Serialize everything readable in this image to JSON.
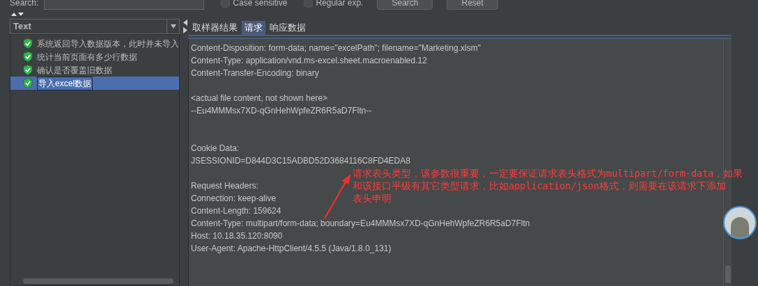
{
  "search_bar": {
    "label": "Search:",
    "case_sensitive": {
      "label": "Case sensitive",
      "checked": false
    },
    "regular_exp": {
      "label": "Regular exp.",
      "checked": false
    },
    "buttons": [
      "Search",
      "Reset"
    ]
  },
  "renderer": {
    "value": "Text"
  },
  "tree": [
    {
      "label": "系统返回导入数据版本，此时并未导入",
      "selected": false
    },
    {
      "label": "统计当前页面有多少行数据",
      "selected": false
    },
    {
      "label": "确认是否覆盖旧数据",
      "selected": false
    },
    {
      "label": "导入excel数据",
      "selected": true
    }
  ],
  "tabs": [
    {
      "label": "取样器结果",
      "selected": false
    },
    {
      "label": "请求",
      "selected": true
    },
    {
      "label": "响应数据",
      "selected": false
    }
  ],
  "request_sections": [
    [
      "Content-Disposition: form-data; name=\"excelPath\"; filename=\"Marketing.xlsm\"",
      "Content-Type: application/vnd.ms-excel.sheet.macroenabled.12",
      "Content-Transfer-Encoding: binary"
    ],
    [
      "<actual file content, not shown here>",
      "--Eu4MMMsx7XD-qGnHehWpfeZR6R5aD7Fltn--"
    ],
    [
      "Cookie Data:",
      "JSESSIONID=D844D3C15ADBD52D3684116C8FD4EDA8"
    ],
    [
      "Request Headers:",
      "Connection: keep-alive",
      "Content-Length: 159624",
      "Content-Type: multipart/form-data; boundary=Eu4MMMsx7XD-qGnHehWpfeZR6R5aD7Fltn",
      "Host: 10.18.35.120:8090",
      "User-Agent: Apache-HttpClient/4.5.5 (Java/1.8.0_131)"
    ]
  ],
  "annotation": [
    "请求表头类型，该参数很重要，一定要保证请求表头格式为multipart/form-data，如果",
    "和该接口平级有其它类型请求，比如application/json格式，则需要在该请求下添加",
    "表头申明"
  ]
}
